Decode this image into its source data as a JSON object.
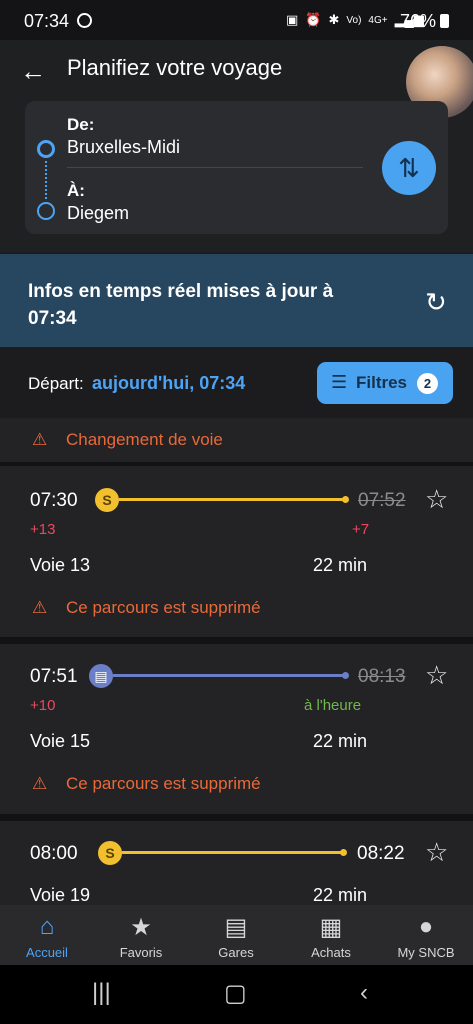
{
  "status_bar": {
    "time": "07:34",
    "icons": [
      "battery-saver-icon",
      "alarm-icon",
      "bluetooth-icon",
      "volte-icon",
      "4g-icon",
      "signal-icon"
    ],
    "battery": "76%"
  },
  "header": {
    "title": "Planifiez votre voyage",
    "from_label": "De:",
    "from_value": "Bruxelles-Midi",
    "to_label": "À:",
    "to_value": "Diegem"
  },
  "banner": {
    "text": "Infos en temps réel mises à jour à 07:34"
  },
  "departure": {
    "label": "Départ:",
    "value": "aujourd'hui, 07:34",
    "filter_label": "Filtres",
    "filter_count": "2"
  },
  "top_partial_warning": "Changement de voie",
  "trips": [
    {
      "depart": "07:30",
      "arrive": "07:52",
      "arrive_struck": true,
      "operator_icon": "S",
      "line_color": "#f2c02f",
      "depart_delay": "+13",
      "arrive_delay": "+7",
      "arrive_delay_type": "red",
      "voie": "Voie 13",
      "duration": "22 min",
      "warning": "Ce parcours est supprimé"
    },
    {
      "depart": "07:51",
      "arrive": "08:13",
      "arrive_struck": true,
      "operator_icon": "train-icon",
      "line_color": "#6a7fc8",
      "depart_delay": "+10",
      "arrive_delay": "à l'heure",
      "arrive_delay_type": "green",
      "voie": "Voie 15",
      "duration": "22 min",
      "warning": "Ce parcours est supprimé"
    },
    {
      "depart": "08:00",
      "arrive": "08:22",
      "arrive_struck": false,
      "operator_icon": "S",
      "line_color": "#f2c02f",
      "depart_delay": "",
      "arrive_delay": "",
      "voie": "Voie 19",
      "duration": "22 min",
      "warning": ""
    }
  ],
  "bottom_nav": [
    {
      "label": "Accueil",
      "icon": "home-icon",
      "active": true
    },
    {
      "label": "Favoris",
      "icon": "star-icon",
      "active": false
    },
    {
      "label": "Gares",
      "icon": "station-icon",
      "active": false
    },
    {
      "label": "Achats",
      "icon": "qr-code-icon",
      "active": false
    },
    {
      "label": "My SNCB",
      "icon": "user-icon",
      "active": false
    }
  ],
  "colors": {
    "accent": "#4aa3f0",
    "banner": "#27465f",
    "warning": "#e8693a",
    "delay_red": "#e8495f",
    "on_time_green": "#6fb84a"
  }
}
